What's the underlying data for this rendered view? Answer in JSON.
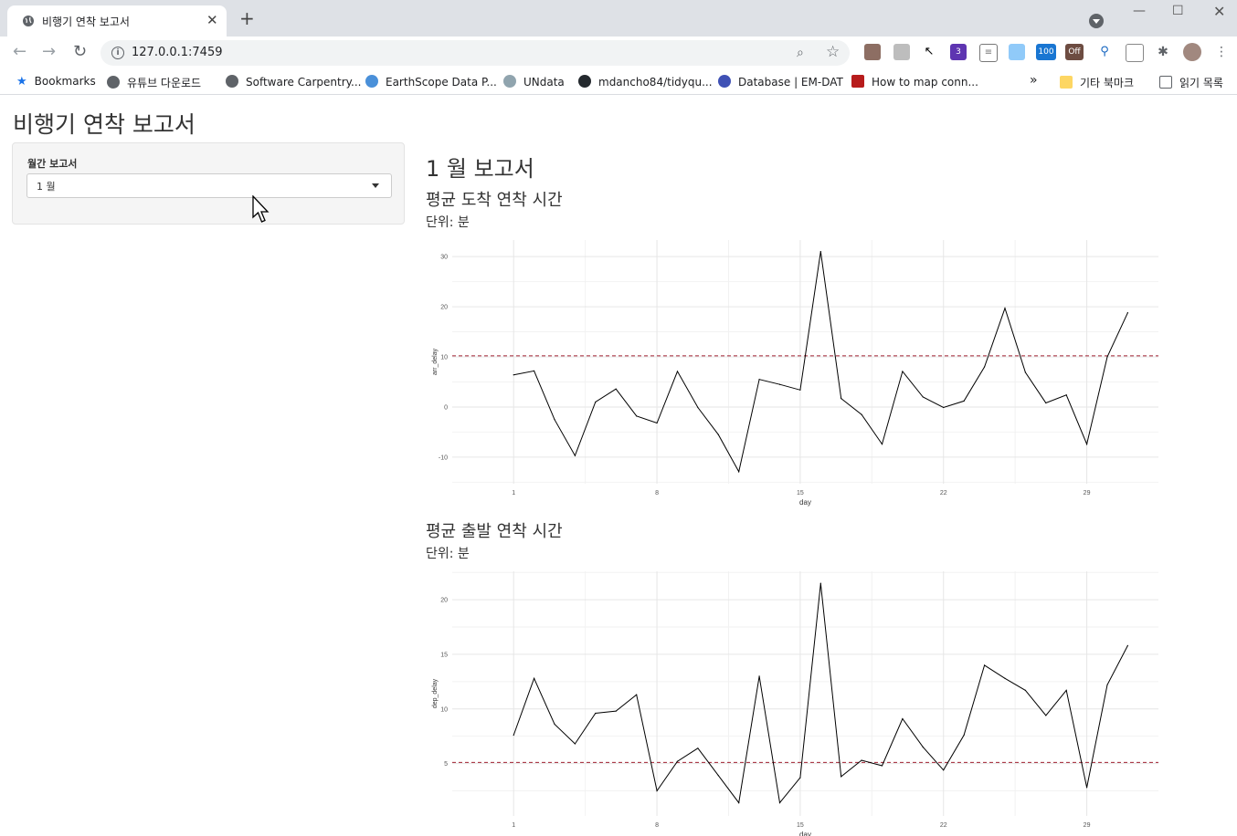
{
  "browser": {
    "tab_title": "비행기 연착 보고서",
    "url": "127.0.0.1:7459",
    "extension_badges": [
      "100",
      "Off",
      "3"
    ],
    "bookmarks": [
      {
        "label": "Bookmarks",
        "icon": "star-icon"
      },
      {
        "label": "유튜브 다운로드",
        "icon": "globe-icon"
      },
      {
        "label": "Software Carpentry...",
        "icon": "globe-icon"
      },
      {
        "label": "EarthScope Data P...",
        "icon": "earthscope-icon"
      },
      {
        "label": "UNdata",
        "icon": "un-icon"
      },
      {
        "label": "mdancho84/tidyqu...",
        "icon": "github-icon"
      },
      {
        "label": "Database | EM-DAT",
        "icon": "emdat-icon"
      },
      {
        "label": "How to map conn...",
        "icon": "f-icon"
      }
    ],
    "overflow_label": "»",
    "other_bookmarks": "기타 북마크",
    "reading_list": "읽기 목록"
  },
  "app": {
    "title": "비행기 연착 보고서",
    "select_label": "월간 보고서",
    "select_value": "1 월",
    "report_title": "1 월 보고서"
  },
  "chart_data": [
    {
      "type": "line",
      "title": "평균 도착 연착 시간",
      "subtitle": "단위: 분",
      "xlabel": "day",
      "ylabel": "arr_delay",
      "x": [
        1,
        2,
        3,
        4,
        5,
        6,
        7,
        8,
        9,
        10,
        11,
        12,
        13,
        14,
        15,
        16,
        17,
        18,
        19,
        20,
        21,
        22,
        23,
        24,
        25,
        26,
        27,
        28,
        29,
        30,
        31
      ],
      "values": [
        6.4,
        7.2,
        -2.5,
        -9.7,
        1.0,
        3.6,
        -1.8,
        -3.2,
        7.1,
        -0.1,
        -5.5,
        -12.9,
        5.5,
        4.5,
        3.4,
        31.0,
        1.7,
        -1.5,
        -7.4,
        7.1,
        2.0,
        -0.1,
        1.2,
        8.0,
        19.7,
        6.9,
        0.8,
        2.4,
        -7.4,
        10.0,
        18.8
      ],
      "reference_line": 10.2,
      "xlim": [
        -2,
        32.5
      ],
      "ylim": [
        -15.3,
        33.3
      ],
      "xticks": [
        1,
        8,
        15,
        22,
        29
      ],
      "yticks": [
        -10,
        0,
        10,
        20,
        30
      ],
      "grid": true
    },
    {
      "type": "line",
      "title": "평균 출발 연착 시간",
      "subtitle": "단위: 분",
      "xlabel": "day",
      "ylabel": "dep_delay",
      "x": [
        1,
        2,
        3,
        4,
        5,
        6,
        7,
        8,
        9,
        10,
        11,
        12,
        13,
        14,
        15,
        16,
        17,
        18,
        19,
        20,
        21,
        22,
        23,
        24,
        25,
        26,
        27,
        28,
        29,
        30,
        31
      ],
      "values": [
        7.6,
        12.8,
        8.6,
        6.8,
        9.6,
        9.8,
        11.3,
        2.5,
        5.2,
        6.4,
        3.9,
        1.4,
        13.0,
        1.4,
        3.7,
        21.5,
        3.8,
        5.3,
        4.8,
        9.1,
        6.5,
        4.4,
        7.6,
        14.0,
        12.8,
        11.7,
        9.4,
        11.7,
        2.8,
        12.2,
        15.8
      ],
      "reference_line": 5.1,
      "xlim": [
        -2,
        32.5
      ],
      "ylim": [
        0.2,
        22.6
      ],
      "xticks": [
        1,
        8,
        15,
        22,
        29
      ],
      "yticks": [
        5,
        10,
        15,
        20
      ],
      "grid": true
    }
  ]
}
